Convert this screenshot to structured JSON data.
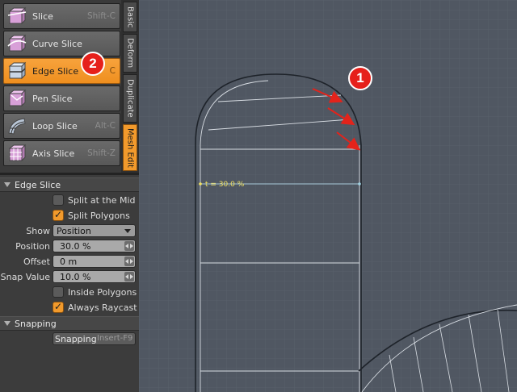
{
  "tools": [
    {
      "label": "Slice",
      "shortcut": "Shift-C",
      "icon": "slice-icon"
    },
    {
      "label": "Curve Slice",
      "shortcut": "",
      "icon": "curve-slice-icon"
    },
    {
      "label": "Edge Slice",
      "shortcut": "C",
      "icon": "edge-slice-icon",
      "active": true
    },
    {
      "label": "Pen Slice",
      "shortcut": "",
      "icon": "pen-slice-icon"
    },
    {
      "label": "Loop Slice",
      "shortcut": "Alt-C",
      "icon": "loop-slice-icon"
    },
    {
      "label": "Axis Slice",
      "shortcut": "Shift-Z",
      "icon": "axis-slice-icon"
    }
  ],
  "tabs": [
    "Basic",
    "Deform",
    "Duplicate",
    "Mesh Edit"
  ],
  "properties": {
    "section_title": "Edge Slice",
    "split_at_mid": "Split at the Mid ...",
    "split_polygons": "Split Polygons",
    "show_label": "Show",
    "show_value": "Position",
    "position_label": "Position",
    "position_value": "30.0 %",
    "offset_label": "Offset",
    "offset_value": "0 m",
    "snap_label": "Snap Value",
    "snap_value": "10.0 %",
    "inside_polygons": "Inside Polygons",
    "always_raycast": "Always Raycast"
  },
  "snapping": {
    "section_title": "Snapping",
    "button_label": "Snapping",
    "button_shortcut": "Insert-F9"
  },
  "viewport": {
    "position_readout": "t = 30.0 %"
  },
  "annotations": {
    "marker1": "1",
    "marker2": "2"
  },
  "colors": {
    "accent": "#f29a2c",
    "marker": "#e6201b",
    "viewport_bg": "#505762",
    "readout": "#f0e060"
  }
}
